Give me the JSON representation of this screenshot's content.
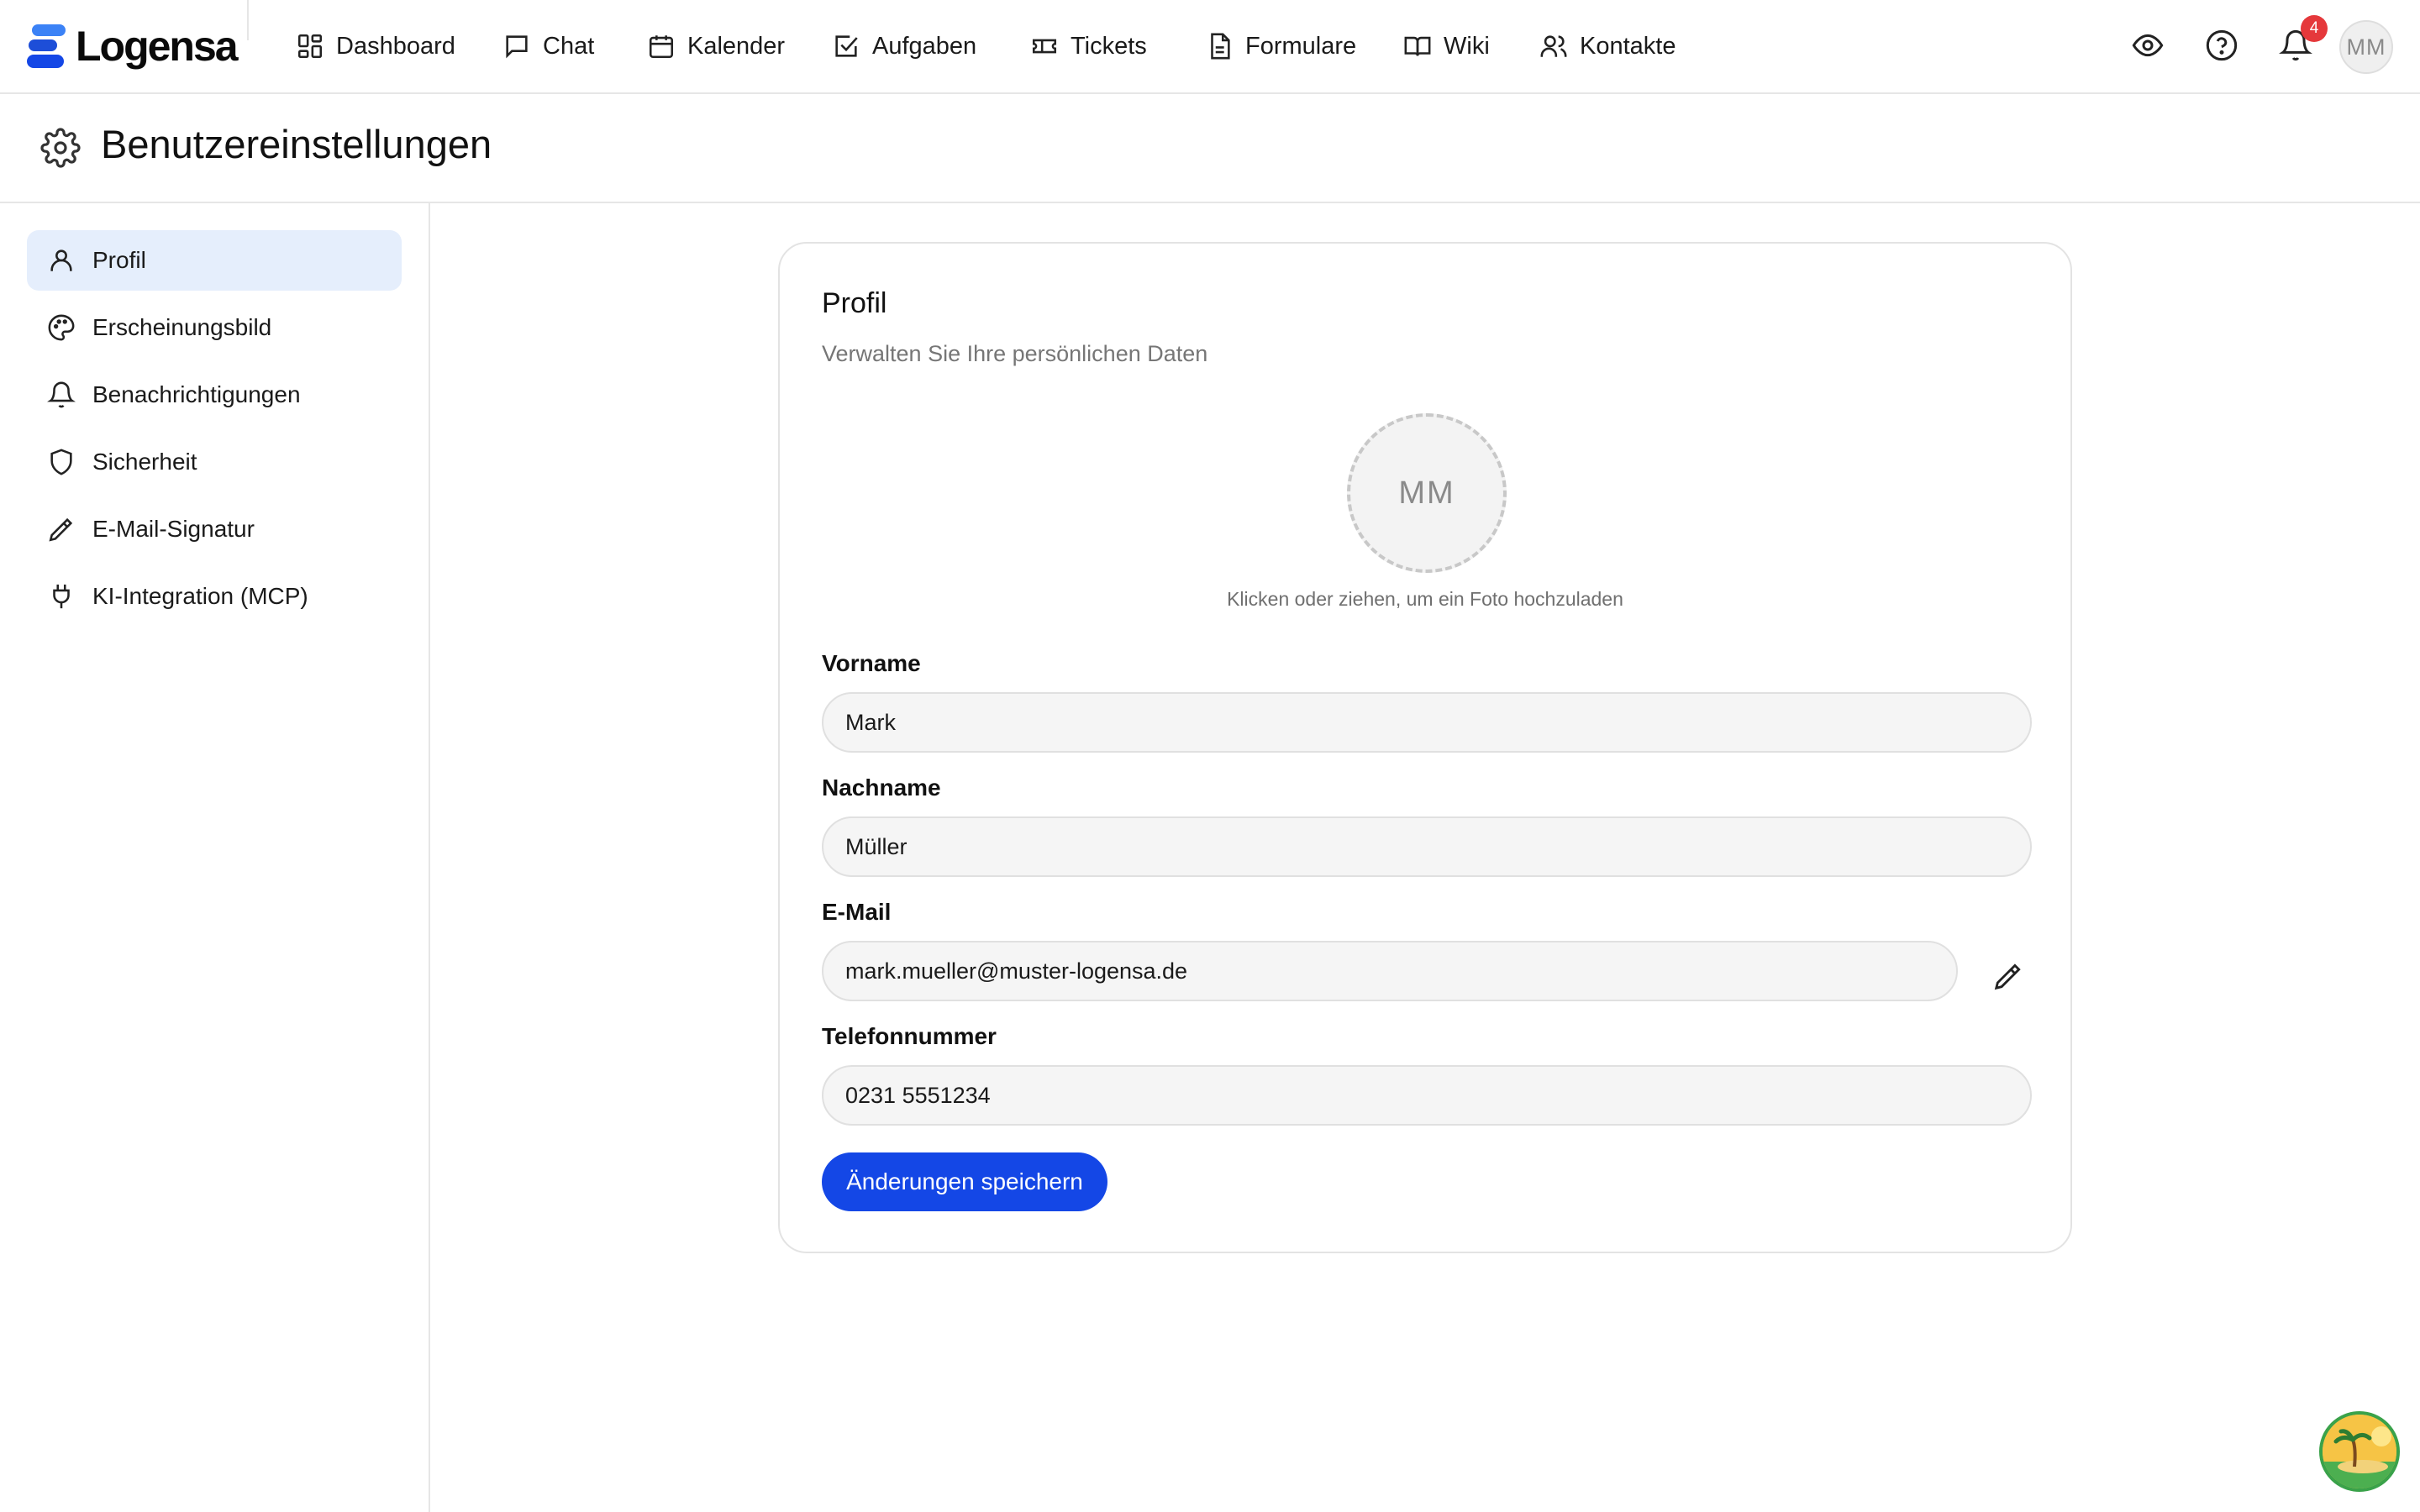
{
  "app": {
    "name": "Logensa"
  },
  "nav": {
    "items": [
      {
        "label": "Dashboard",
        "icon": "dashboard-icon"
      },
      {
        "label": "Chat",
        "icon": "chat-icon"
      },
      {
        "label": "Kalender",
        "icon": "calendar-icon"
      },
      {
        "label": "Aufgaben",
        "icon": "task-icon"
      },
      {
        "label": "Tickets",
        "icon": "ticket-icon"
      },
      {
        "label": "Formulare",
        "icon": "form-icon"
      },
      {
        "label": "Wiki",
        "icon": "book-icon"
      },
      {
        "label": "Kontakte",
        "icon": "contacts-icon"
      }
    ]
  },
  "topbar": {
    "notification_count": "4",
    "user_initials": "MM"
  },
  "page": {
    "title": "Benutzereinstellungen"
  },
  "sidebar": {
    "items": [
      {
        "label": "Profil",
        "icon": "user-icon",
        "active": true
      },
      {
        "label": "Erscheinungsbild",
        "icon": "palette-icon"
      },
      {
        "label": "Benachrichtigungen",
        "icon": "bell-icon"
      },
      {
        "label": "Sicherheit",
        "icon": "shield-icon"
      },
      {
        "label": "E-Mail-Signatur",
        "icon": "pen-icon"
      },
      {
        "label": "KI-Integration (MCP)",
        "icon": "plug-icon"
      }
    ]
  },
  "profile": {
    "title": "Profil",
    "subtitle": "Verwalten Sie Ihre persönlichen Daten",
    "avatar_initials": "MM",
    "upload_hint": "Klicken oder ziehen, um ein Foto hochzuladen",
    "fields": {
      "first_name": {
        "label": "Vorname",
        "value": "Mark"
      },
      "last_name": {
        "label": "Nachname",
        "value": "Müller"
      },
      "email": {
        "label": "E-Mail",
        "value": "mark.mueller@muster-logensa.de"
      },
      "phone": {
        "label": "Telefonnummer",
        "value": "0231 5551234"
      }
    },
    "save_label": "Änderungen speichern"
  },
  "colors": {
    "accent": "#1447e6",
    "active_nav_bg": "#e5eefc",
    "badge": "#e5383b"
  }
}
